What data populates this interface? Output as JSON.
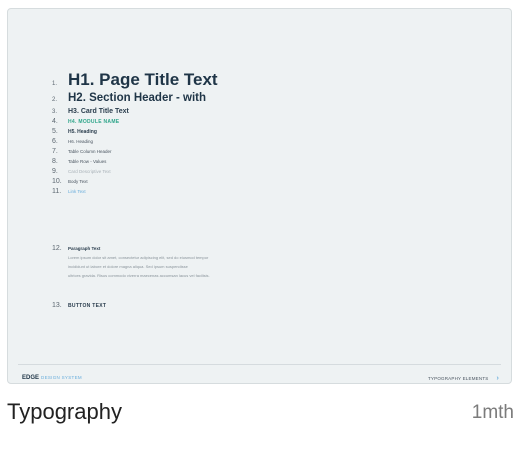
{
  "thumbnail": {
    "rows": [
      {
        "num": "1.",
        "text": "H1. Page Title Text"
      },
      {
        "num": "2.",
        "text": "H2. Section Header - with"
      },
      {
        "num": "3.",
        "text": "H3. Card Title Text"
      },
      {
        "num": "4.",
        "text": "H4. MODULE NAME"
      },
      {
        "num": "5.",
        "text": "H5. Heading"
      },
      {
        "num": "6.",
        "text": "H6. Heading"
      },
      {
        "num": "7.",
        "text": "Table Column Header"
      },
      {
        "num": "8.",
        "text": "Table Row - Values"
      },
      {
        "num": "9.",
        "text": "Card Descriptive Text"
      },
      {
        "num": "10.",
        "text": "Body Text"
      },
      {
        "num": "11.",
        "text": "Link Text"
      }
    ],
    "paragraph": {
      "num": "12.",
      "title": "Paragraph Text",
      "lines": [
        "Lorem ipsum dolor sit amet, consectetur adipiscing elit, sed do eiusmod tempor",
        "incididunt ut labore et dolore magna aliqua. Sed ipsum suspendisse",
        "ultrices gravida. Risus commodo viverra maecenas accumsan lacus vel facilisis."
      ]
    },
    "button": {
      "num": "13.",
      "text": "BUTTON TEXT"
    },
    "footer": {
      "brand": "EDGE",
      "brand_sub": "DESIGN SYSTEM",
      "section": "TYPOGRAPHY ELEMENTS",
      "chevron": "›"
    }
  },
  "caption": {
    "title": "Typography",
    "time": "1mth"
  },
  "colors": {
    "thumb_bg": "#eef2f3",
    "heading": "#1f3547",
    "accent_green": "#2fa58a",
    "link_blue": "#6aaedc"
  }
}
